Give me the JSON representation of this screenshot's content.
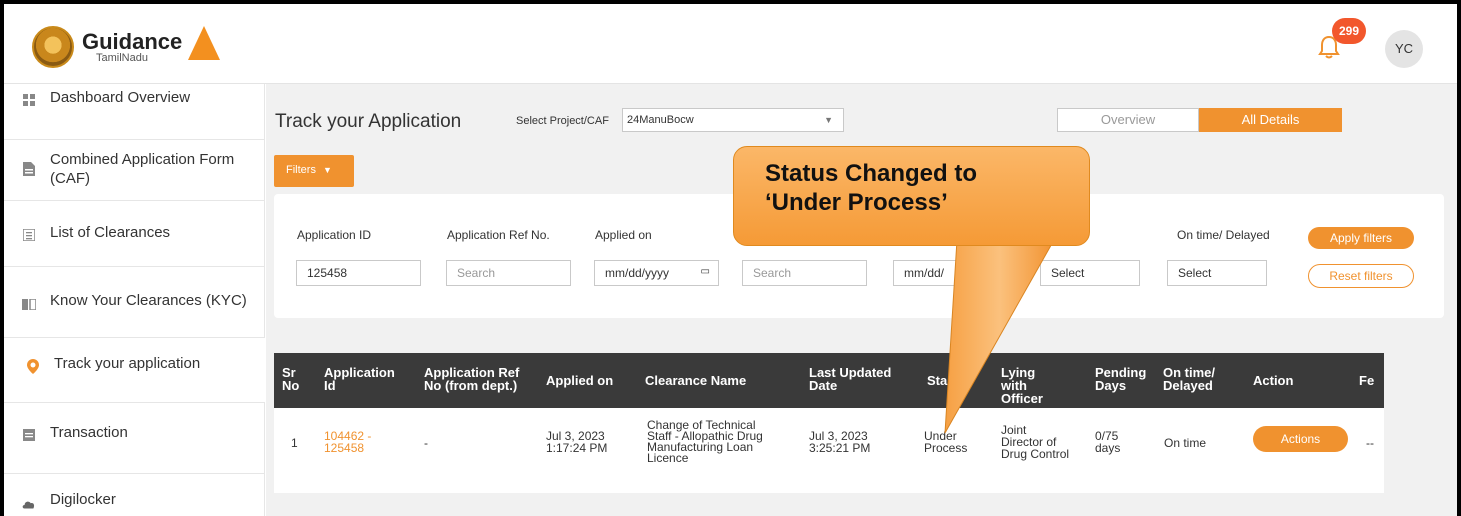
{
  "header": {
    "logo_main": "Guidance",
    "logo_sub": "TamilNadu",
    "notification_count": "299",
    "avatar_initials": "YC"
  },
  "sidebar": {
    "items": [
      {
        "label": "Dashboard Overview",
        "icon": "grid-icon"
      },
      {
        "label": "Combined Application Form (CAF)",
        "icon": "document-icon"
      },
      {
        "label": "List of Clearances",
        "icon": "list-icon"
      },
      {
        "label": "Know Your Clearances (KYC)",
        "icon": "book-icon"
      },
      {
        "label": "Track your application",
        "icon": "location-pin-icon"
      },
      {
        "label": "Transaction",
        "icon": "transaction-icon"
      },
      {
        "label": "Digilocker",
        "icon": "cloud-icon"
      }
    ]
  },
  "main": {
    "title": "Track your Application",
    "select_label": "Select Project/CAF",
    "select_value": "24ManuBocw",
    "view_tabs": [
      "Overview",
      "All Details"
    ],
    "filters_label": "Filters"
  },
  "filters": {
    "application_id_label": "Application ID",
    "application_id_value": "125458",
    "ref_no_label": "Application Ref No.",
    "ref_no_placeholder": "Search",
    "applied_on_label": "Applied on",
    "applied_on_placeholder": "mm/dd/yyyy",
    "clearance_placeholder": "Search",
    "updated_placeholder": "mm/dd/",
    "status_select": "Select",
    "ontime_label": "On time/ Delayed",
    "ontime_select": "Select",
    "apply_label": "Apply filters",
    "reset_label": "Reset filters"
  },
  "table": {
    "headers": [
      "Sr No",
      "Application Id",
      "Application Ref No (from dept.)",
      "Applied on",
      "Clearance Name",
      "Last Updated Date",
      "Sta",
      "Lying with Officer",
      "Pending Days",
      "On time/ Delayed",
      "Action",
      "Fe"
    ],
    "row": {
      "sr": "1",
      "app_id_1": "104462 -",
      "app_id_2": "125458",
      "ref": "-",
      "applied_1": "Jul 3, 2023",
      "applied_2": "1:17:24 PM",
      "clearance_1": "Change of Technical",
      "clearance_2": "Staff - Allopathic Drug",
      "clearance_3": "Manufacturing Loan",
      "clearance_4": "Licence",
      "updated_1": "Jul 3, 2023",
      "updated_2": "3:25:21 PM",
      "status_1": "Under",
      "status_2": "Process",
      "officer_1": "Joint",
      "officer_2": "Director of",
      "officer_3": "Drug Control",
      "pending_1": "0/75",
      "pending_2": "days",
      "ontime": "On time",
      "action": "Actions",
      "fee": "--"
    }
  },
  "callout": {
    "line1": "Status Changed to",
    "line2": "‘Under Process’"
  },
  "colors": {
    "accent": "#f0922f",
    "header_dark": "#3a3a3a",
    "badge": "#f2572c"
  }
}
